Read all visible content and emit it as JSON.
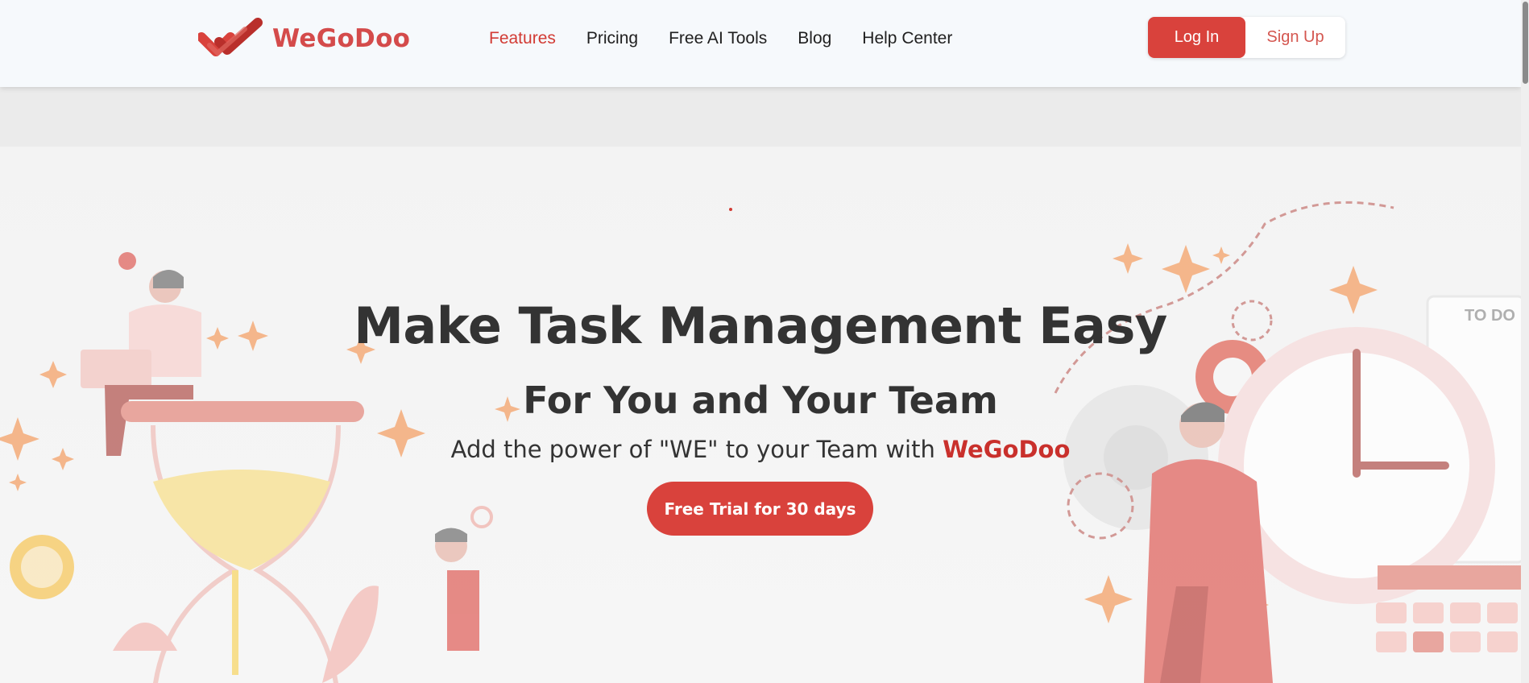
{
  "brand": {
    "name": "WeGoDoo",
    "logo_color": "#d44b4b"
  },
  "nav": {
    "items": [
      {
        "label": "Features",
        "active": true
      },
      {
        "label": "Pricing",
        "active": false
      },
      {
        "label": "Free AI Tools",
        "active": false
      },
      {
        "label": "Blog",
        "active": false
      },
      {
        "label": "Help Center",
        "active": false
      }
    ]
  },
  "auth": {
    "login_label": "Log In",
    "signup_label": "Sign Up"
  },
  "hero": {
    "title": "Make Task Management Easy",
    "subtitle": "For You and Your Team",
    "tagline_prefix": "Add the power of \"WE\" to your Team with ",
    "tagline_brand": "WeGoDoo",
    "cta_label": "Free Trial for 30 days",
    "todo_label": "TO DO"
  },
  "colors": {
    "accent": "#d9423c",
    "text": "#333333",
    "illustration": "#e89a90",
    "star": "#f4a268"
  },
  "icons": [
    "logo-icon",
    "hourglass-illustration",
    "clock-illustration",
    "gear-icon",
    "star-icon",
    "person-illustration"
  ]
}
